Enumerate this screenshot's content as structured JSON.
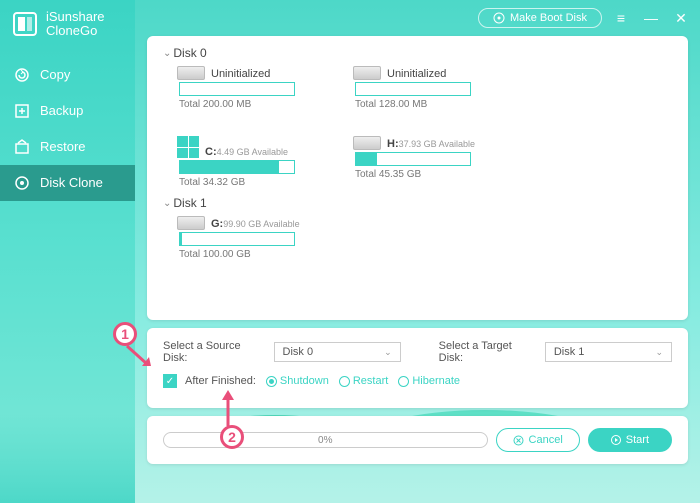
{
  "app": {
    "name_line1": "iSunshare",
    "name_line2": "CloneGo"
  },
  "titlebar": {
    "make_boot": "Make Boot Disk"
  },
  "nav": {
    "copy": "Copy",
    "backup": "Backup",
    "restore": "Restore",
    "disk_clone": "Disk Clone"
  },
  "disks": {
    "d0": {
      "title": "Disk 0",
      "p0": {
        "label": "Uninitialized",
        "total": "Total 200.00 MB",
        "fill": 0
      },
      "p1": {
        "label": "Uninitialized",
        "total": "Total 128.00 MB",
        "fill": 0
      },
      "p2": {
        "label_drive": "C:",
        "avail": "4.49 GB Available",
        "total": "Total 34.32 GB",
        "fill": 87
      },
      "p3": {
        "label_drive": "H:",
        "avail": "37.93 GB Available",
        "total": "Total 45.35 GB",
        "fill": 18
      }
    },
    "d1": {
      "title": "Disk 1",
      "p0": {
        "label_drive": "G:",
        "avail": "99.90 GB Available",
        "total": "Total 100.00 GB",
        "fill": 1
      }
    }
  },
  "config": {
    "source_label": "Select a Source Disk:",
    "source_value": "Disk 0",
    "target_label": "Select a Target Disk:",
    "target_value": "Disk 1",
    "after_label": "After Finished:",
    "opts": {
      "shutdown": "Shutdown",
      "restart": "Restart",
      "hibernate": "Hibernate"
    }
  },
  "actions": {
    "progress_text": "0%",
    "cancel": "Cancel",
    "start": "Start"
  },
  "callouts": {
    "c1": "1",
    "c2": "2"
  }
}
